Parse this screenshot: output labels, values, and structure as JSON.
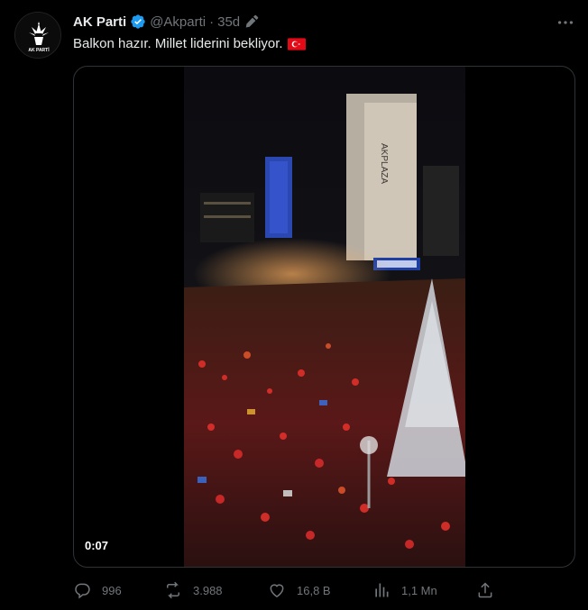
{
  "tweet": {
    "author_name": "AK Parti",
    "handle": "@Akparti",
    "separator": "·",
    "time": "35d",
    "text": "Balkon hazır. Millet liderini bekliyor.",
    "avatar_text": "AK PARTİ",
    "flag_icon": "turkey-flag-icon"
  },
  "media": {
    "duration": "0:07",
    "sign_text": "AKPLAZA"
  },
  "actions": {
    "replies": "996",
    "reposts": "3.988",
    "likes": "16,8 B",
    "views": "1,1 Mn"
  },
  "colors": {
    "background": "#000000",
    "text": "#e7e9ea",
    "muted": "#71767b",
    "verified": "#1d9bf0",
    "border": "#2f3336"
  }
}
